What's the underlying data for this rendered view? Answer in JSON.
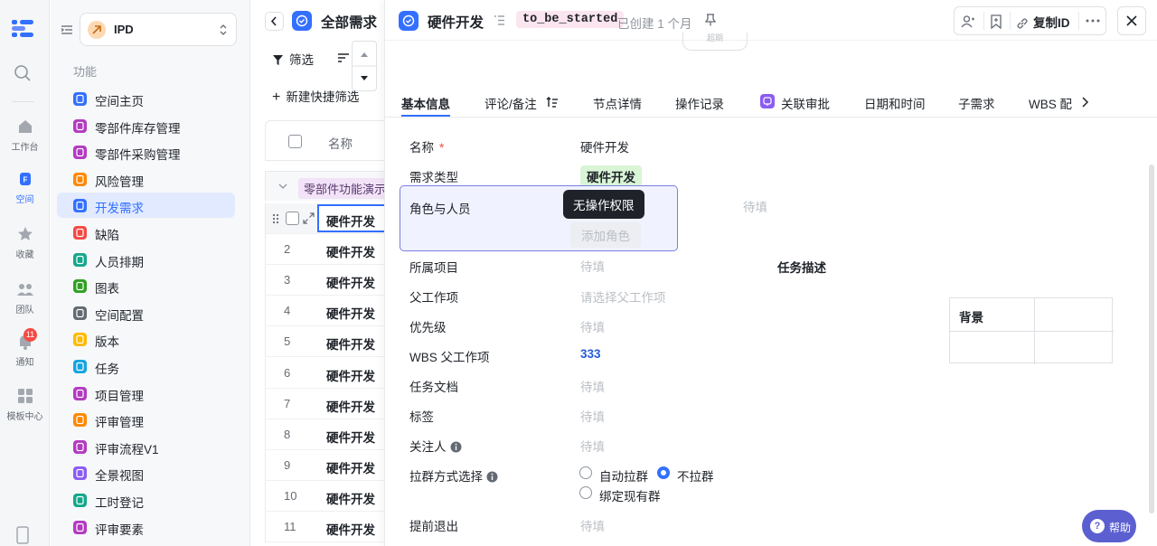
{
  "rail": {
    "items": [
      {
        "label": "工作台"
      },
      {
        "label": "空间"
      },
      {
        "label": "收藏"
      },
      {
        "label": "团队"
      },
      {
        "label": "通知"
      },
      {
        "label": "模板中心"
      }
    ],
    "notif_count": "11"
  },
  "sidebar": {
    "project_name": "IPD",
    "section_label": "功能",
    "items": [
      {
        "label": "空间主页",
        "color": "#3370ff"
      },
      {
        "label": "零部件库存管理",
        "color": "#b33ac1"
      },
      {
        "label": "零部件采购管理",
        "color": "#b33ac1"
      },
      {
        "label": "风险管理",
        "color": "#ff8800"
      },
      {
        "label": "开发需求",
        "color": "#3370ff"
      },
      {
        "label": "缺陷",
        "color": "#f54a45"
      },
      {
        "label": "人员排期",
        "color": "#14a78c"
      },
      {
        "label": "图表",
        "color": "#2ea121"
      },
      {
        "label": "空间配置",
        "color": "#646a73"
      },
      {
        "label": "版本",
        "color": "#ffba00"
      },
      {
        "label": "任务",
        "color": "#16a4e0"
      },
      {
        "label": "项目管理",
        "color": "#b33ac1"
      },
      {
        "label": "评审管理",
        "color": "#ff8800"
      },
      {
        "label": "评审流程V1",
        "color": "#b33ac1"
      },
      {
        "label": "全景视图",
        "color": "#8a5cf5"
      },
      {
        "label": "工时登记",
        "color": "#14a78c"
      },
      {
        "label": "评审要素",
        "color": "#b33ac1"
      }
    ]
  },
  "list": {
    "title": "全部需求",
    "filter_label": "筛选",
    "new_filter_label": "新建快捷筛选",
    "col_name": "名称",
    "group_label": "零部件功能演示",
    "rows": [
      {
        "num": "",
        "title": "硬件开发"
      },
      {
        "num": "2",
        "title": "硬件开发"
      },
      {
        "num": "3",
        "title": "硬件开发"
      },
      {
        "num": "4",
        "title": "硬件开发"
      },
      {
        "num": "5",
        "title": "硬件开发"
      },
      {
        "num": "6",
        "title": "硬件开发"
      },
      {
        "num": "7",
        "title": "硬件开发"
      },
      {
        "num": "8",
        "title": "硬件开发"
      },
      {
        "num": "9",
        "title": "硬件开发"
      },
      {
        "num": "10",
        "title": "硬件开发"
      },
      {
        "num": "11",
        "title": "硬件开发"
      }
    ]
  },
  "detail": {
    "title": "硬件开发",
    "status": "to_be_started",
    "created": "已创建 1 个月",
    "copy_id": "复制ID",
    "node_pill": "超期",
    "tabs": [
      "基本信息",
      "评论/备注",
      "节点详情",
      "操作记录",
      "关联审批",
      "日期和时间",
      "子需求",
      "WBS 配"
    ],
    "fields": {
      "name_label": "名称",
      "name_value": "硬件开发",
      "type_label": "需求类型",
      "type_value": "硬件开发",
      "role_label": "角色与人员",
      "role_tooltip": "无操作权限",
      "add_role": "添加角色",
      "role_right_placeholder": "待填",
      "project_label": "所属项目",
      "project_value": "待填",
      "parent_label": "父工作项",
      "parent_value": "请选择父工作项",
      "priority_label": "优先级",
      "priority_value": "待填",
      "wbs_label": "WBS 父工作项",
      "wbs_value": "333",
      "doc_label": "任务文档",
      "doc_value": "待填",
      "tag_label": "标签",
      "tag_value": "待填",
      "follower_label": "关注人",
      "follower_value": "待填",
      "group_label": "拉群方式选择",
      "group_opt1": "自动拉群",
      "group_opt2": "不拉群",
      "group_opt3": "绑定现有群",
      "group_selected": "不拉群",
      "exit_label": "提前退出",
      "exit_value": "待填",
      "task_desc_label": "任务描述",
      "bg_label": "背景"
    },
    "help": "帮助"
  }
}
